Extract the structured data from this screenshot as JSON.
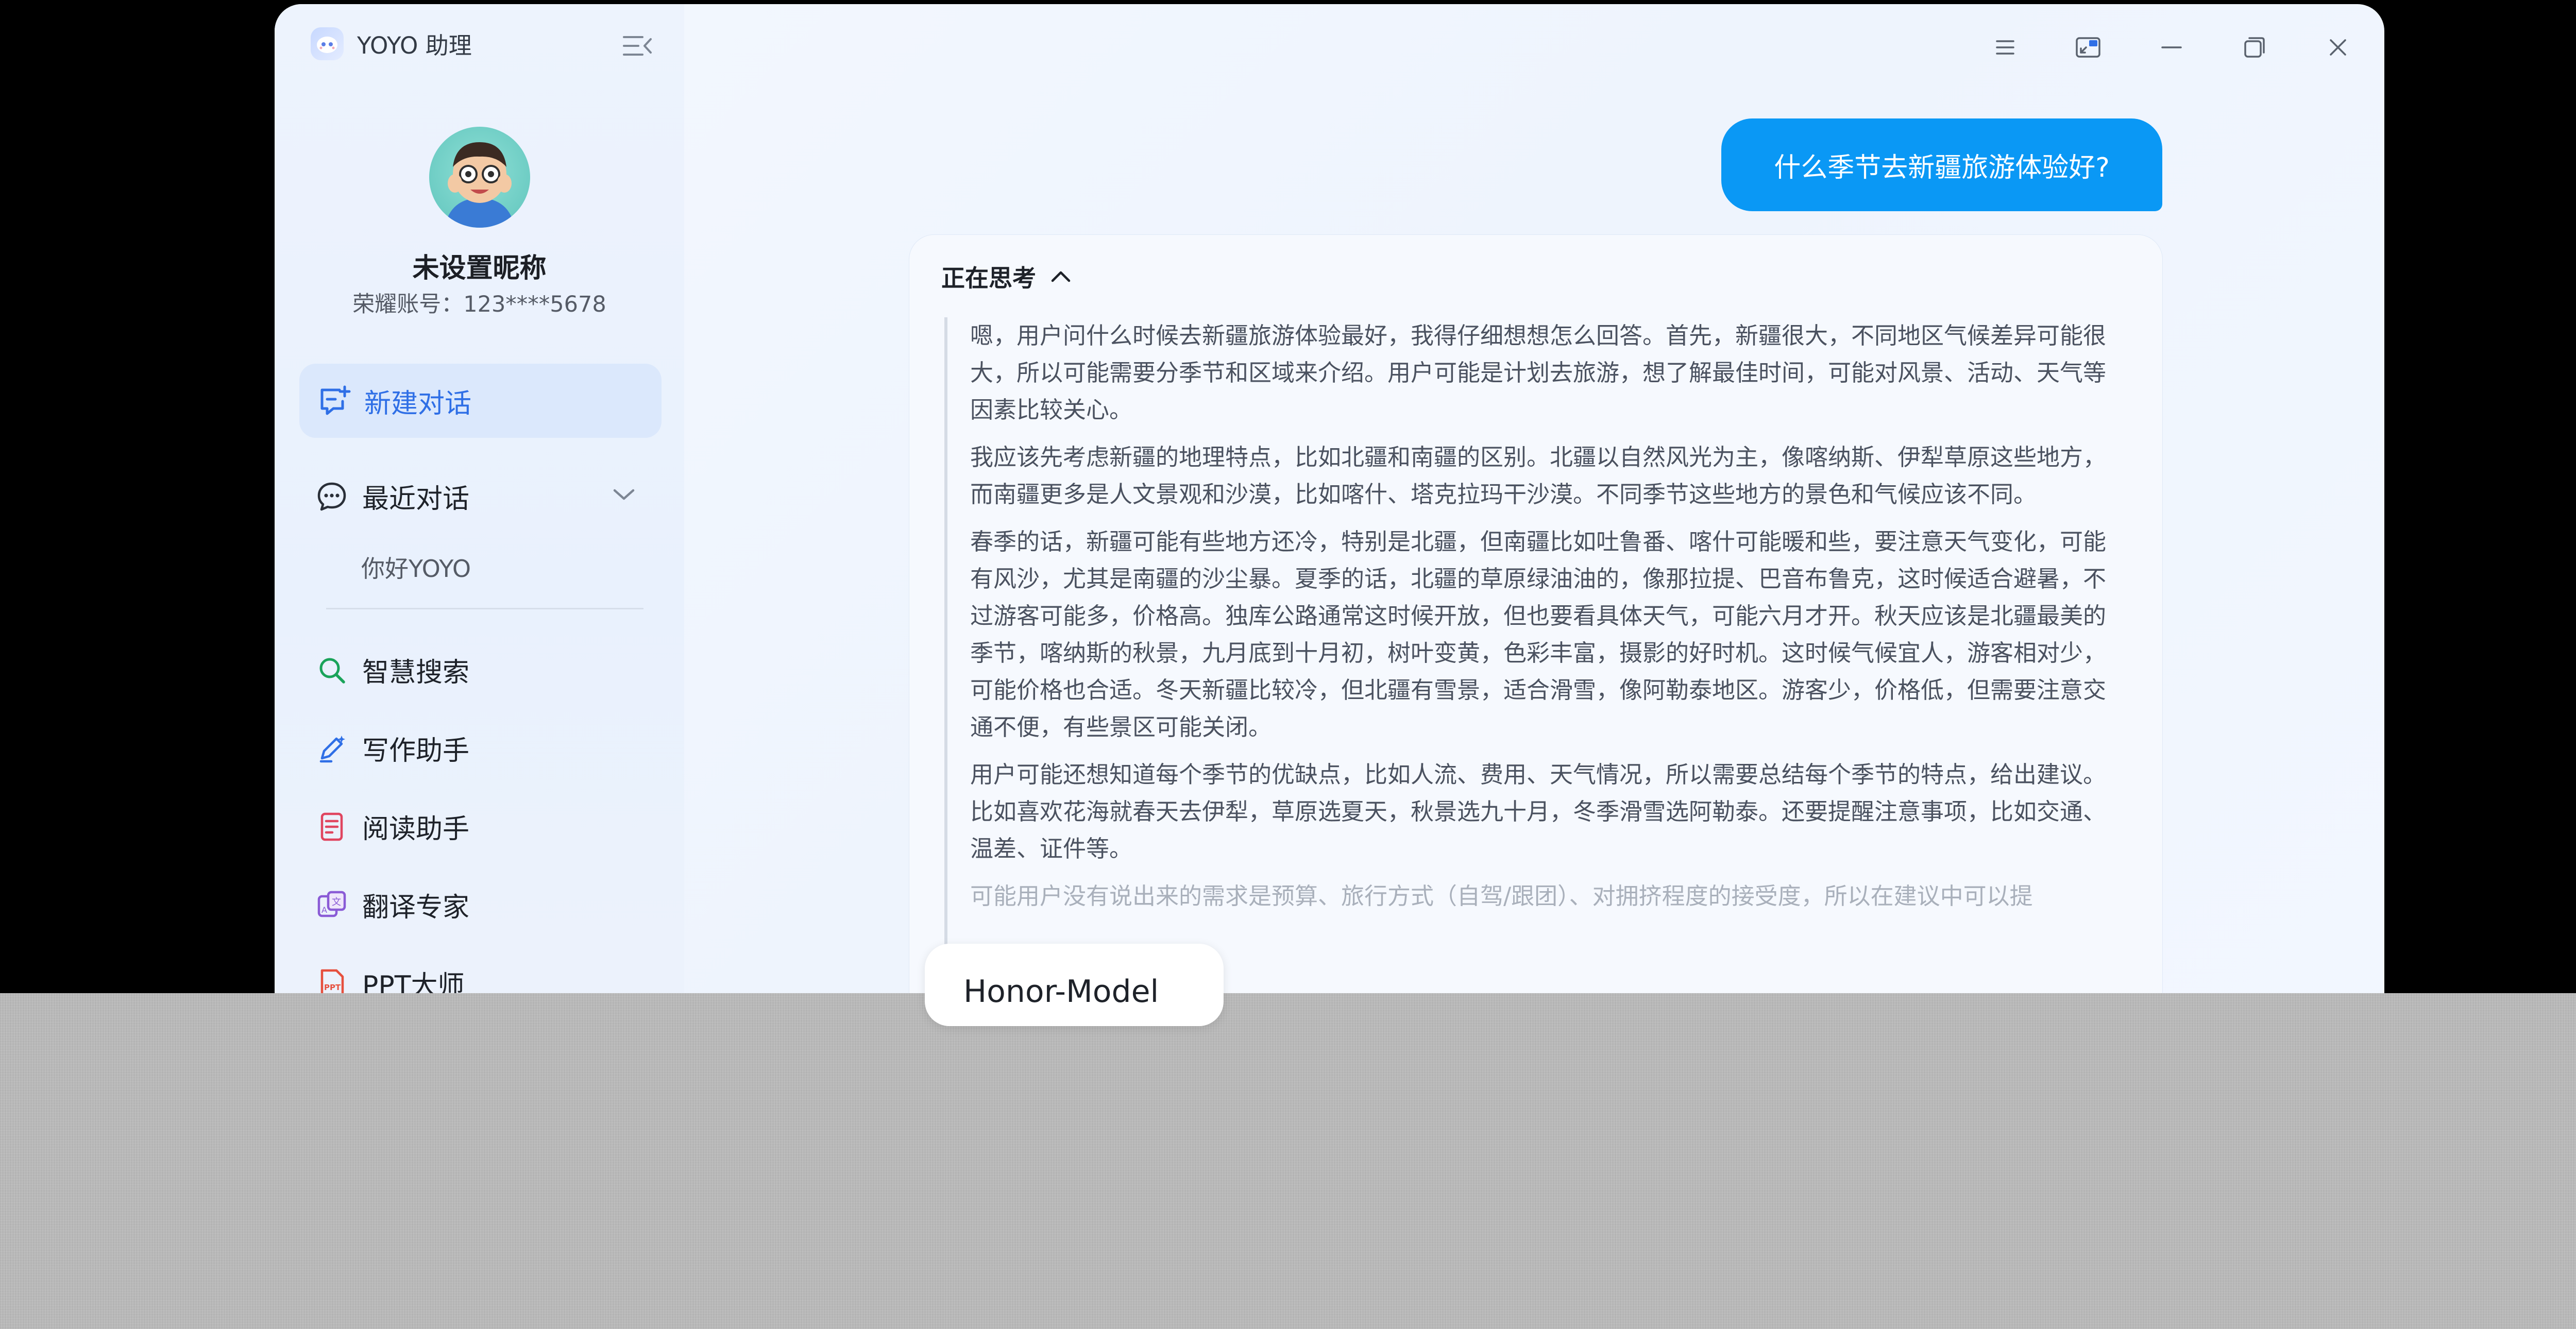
{
  "app": {
    "title": "YOYO 助理"
  },
  "profile": {
    "nickname": "未设置昵称",
    "account": "荣耀账号：123****5678"
  },
  "sidebar": {
    "new_chat": "新建对话",
    "recent": {
      "label": "最近对话",
      "items": [
        "你好YOYO"
      ]
    },
    "tools": [
      {
        "label": "智慧搜索",
        "icon": "search-icon",
        "color": "#1aa35a"
      },
      {
        "label": "写作助手",
        "icon": "pen-icon",
        "color": "#2f6fe6"
      },
      {
        "label": "阅读助手",
        "icon": "document-icon",
        "color": "#e0455f"
      },
      {
        "label": "翻译专家",
        "icon": "translate-icon",
        "color": "#8a5bd6"
      },
      {
        "label": "PPT大师",
        "icon": "ppt-icon",
        "color": "#e6503e"
      }
    ]
  },
  "chat": {
    "user_message": "什么季节去新疆旅游体验好?",
    "thinking_label": "正在思考",
    "thinking_paragraphs": [
      "嗯，用户问什么时候去新疆旅游体验最好，我得仔细想想怎么回答。首先，新疆很大，不同地区气候差异可能很大，所以可能需要分季节和区域来介绍。用户可能是计划去旅游，想了解最佳时间，可能对风景、活动、天气等因素比较关心。",
      "我应该先考虑新疆的地理特点，比如北疆和南疆的区别。北疆以自然风光为主，像喀纳斯、伊犁草原这些地方，而南疆更多是人文景观和沙漠，比如喀什、塔克拉玛干沙漠。不同季节这些地方的景色和气候应该不同。",
      "春季的话，新疆可能有些地方还冷，特别是北疆，但南疆比如吐鲁番、喀什可能暖和些，要注意天气变化，可能有风沙，尤其是南疆的沙尘暴。夏季的话，北疆的草原绿油油的，像那拉提、巴音布鲁克，这时候适合避暑，不过游客可能多，价格高。独库公路通常这时候开放，但也要看具体天气，可能六月才开。秋天应该是北疆最美的季节，喀纳斯的秋景，九月底到十月初，树叶变黄，色彩丰富，摄影的好时机。这时候气候宜人，游客相对少，可能价格也合适。冬天新疆比较冷，但北疆有雪景，适合滑雪，像阿勒泰地区。游客少，价格低，但需要注意交通不便，有些景区可能关闭。",
      "用户可能还想知道每个季节的优缺点，比如人流、费用、天气情况，所以需要总结每个季节的特点，给出建议。比如喜欢花海就春天去伊犁，草原选夏天，秋景选九十月，冬季滑雪选阿勒泰。还要提醒注意事项，比如交通、温差、证件等。",
      "可能用户没有说出来的需求是预算、旅行方式（自驾/跟团）、对拥挤程度的接受度，所以在建议中可以提"
    ],
    "model_chip": "Honor-Model"
  },
  "colors": {
    "accent": "#0a98f5",
    "brand_blue": "#2f6fe6",
    "sidebar_bg": "#edf3fd"
  }
}
